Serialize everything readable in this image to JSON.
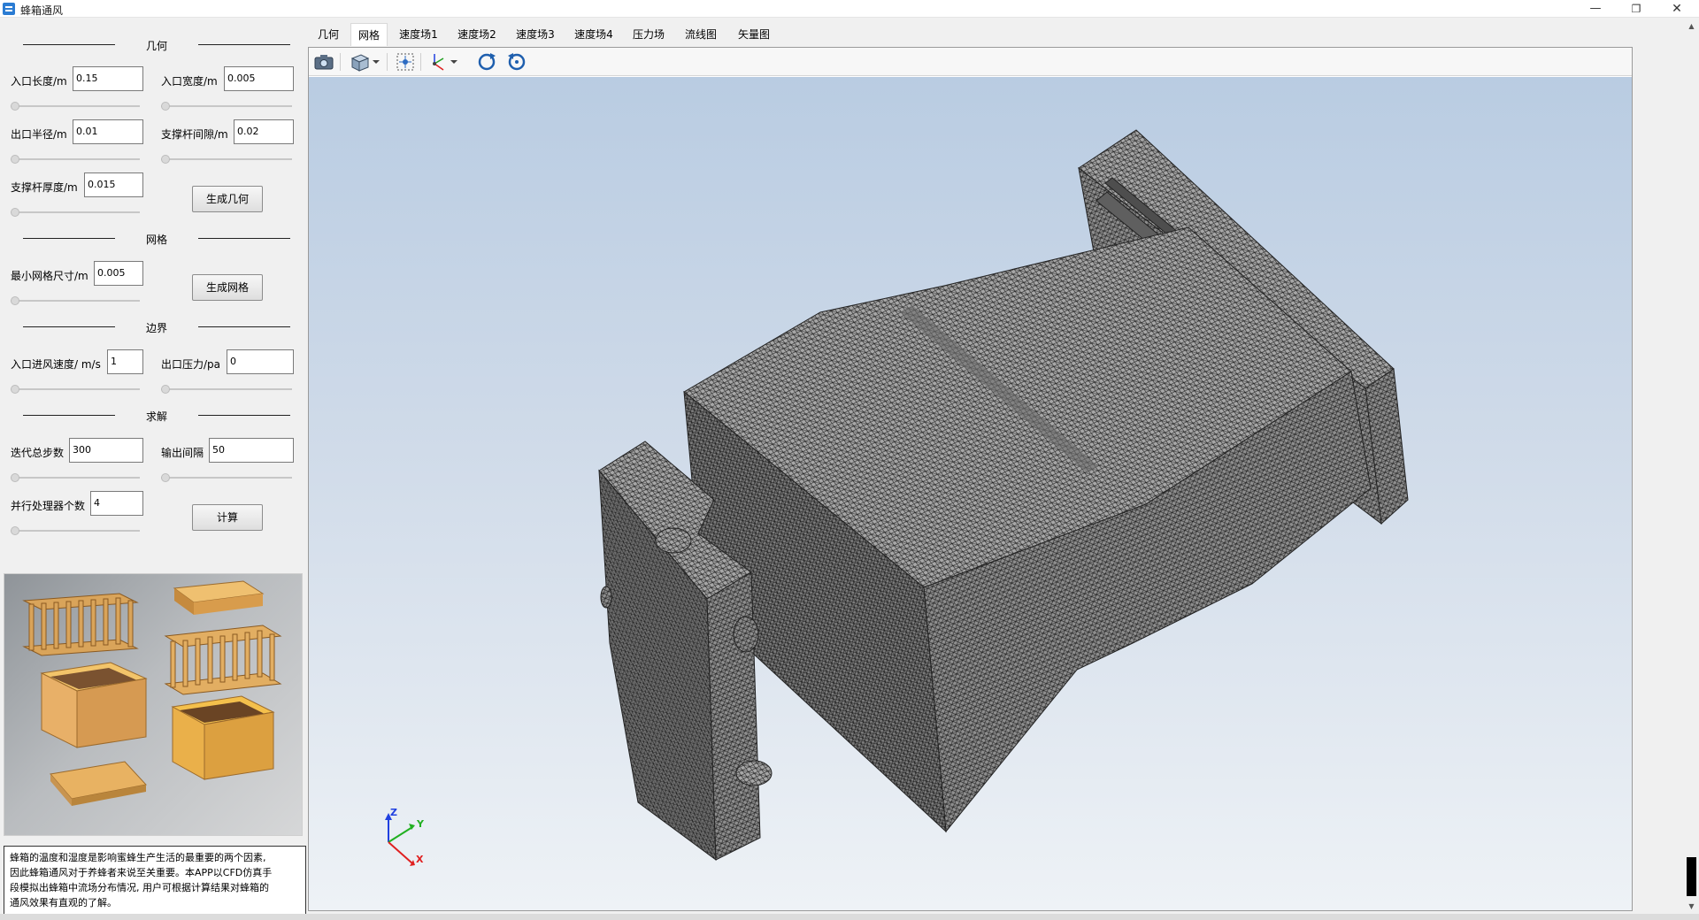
{
  "window": {
    "title": "蜂箱通风",
    "min_glyph": "—",
    "max_glyph": "❐",
    "close_glyph": "✕"
  },
  "left": {
    "sections": {
      "geometry": "几何",
      "mesh": "网格",
      "boundary": "边界",
      "solve": "求解"
    },
    "inlet_length": {
      "label": "入口长度/m",
      "value": "0.15"
    },
    "inlet_width": {
      "label": "入口宽度/m",
      "value": "0.005"
    },
    "outlet_radius": {
      "label": "出口半径/m",
      "value": "0.01"
    },
    "strut_spacing": {
      "label": "支撑杆间隙/m",
      "value": "0.02"
    },
    "strut_thickness": {
      "label": "支撑杆厚度/m",
      "value": "0.015"
    },
    "gen_geometry_button": "生成几何",
    "min_mesh_size": {
      "label": "最小网格尺寸/m",
      "value": "0.005"
    },
    "gen_mesh_button": "生成网格",
    "inlet_velocity": {
      "label": "入口进风速度/ m/s",
      "value": "1"
    },
    "outlet_pressure": {
      "label": "出口压力/pa",
      "value": "0"
    },
    "total_iterations": {
      "label": "迭代总步数",
      "value": "300"
    },
    "output_interval": {
      "label": "输出间隔",
      "value": "50"
    },
    "processors": {
      "label": "并行处理器个数",
      "value": "4"
    },
    "compute_button": "计算",
    "description": [
      "蜂箱的温度和湿度是影响蜜蜂生产生活的最重要的两个因素,",
      "因此蜂箱通风对于养蜂者来说至关重要。本APP以CFD仿真手",
      "段模拟出蜂箱中流场分布情况, 用户可根据计算结果对蜂箱的",
      "通风效果有直观的了解。"
    ]
  },
  "tabs": [
    "几何",
    "网格",
    "速度场1",
    "速度场2",
    "速度场3",
    "速度场4",
    "压力场",
    "流线图",
    "矢量图"
  ],
  "active_tab": "网格",
  "toolbar_icons": [
    "camera-icon",
    "view-cube-icon",
    "dropdown-icon",
    "zoom-fit-icon",
    "axes-icon",
    "dropdown-icon",
    "rotate-icon",
    "reset-view-icon"
  ],
  "triad": {
    "z": "Z",
    "y": "Y",
    "x": "X"
  },
  "colors": {
    "mesh_face": "#a8a8a8",
    "mesh_line": "#1e1e1e",
    "axis_x": "#e02020",
    "axis_y": "#20b020",
    "axis_z": "#2040e0"
  }
}
